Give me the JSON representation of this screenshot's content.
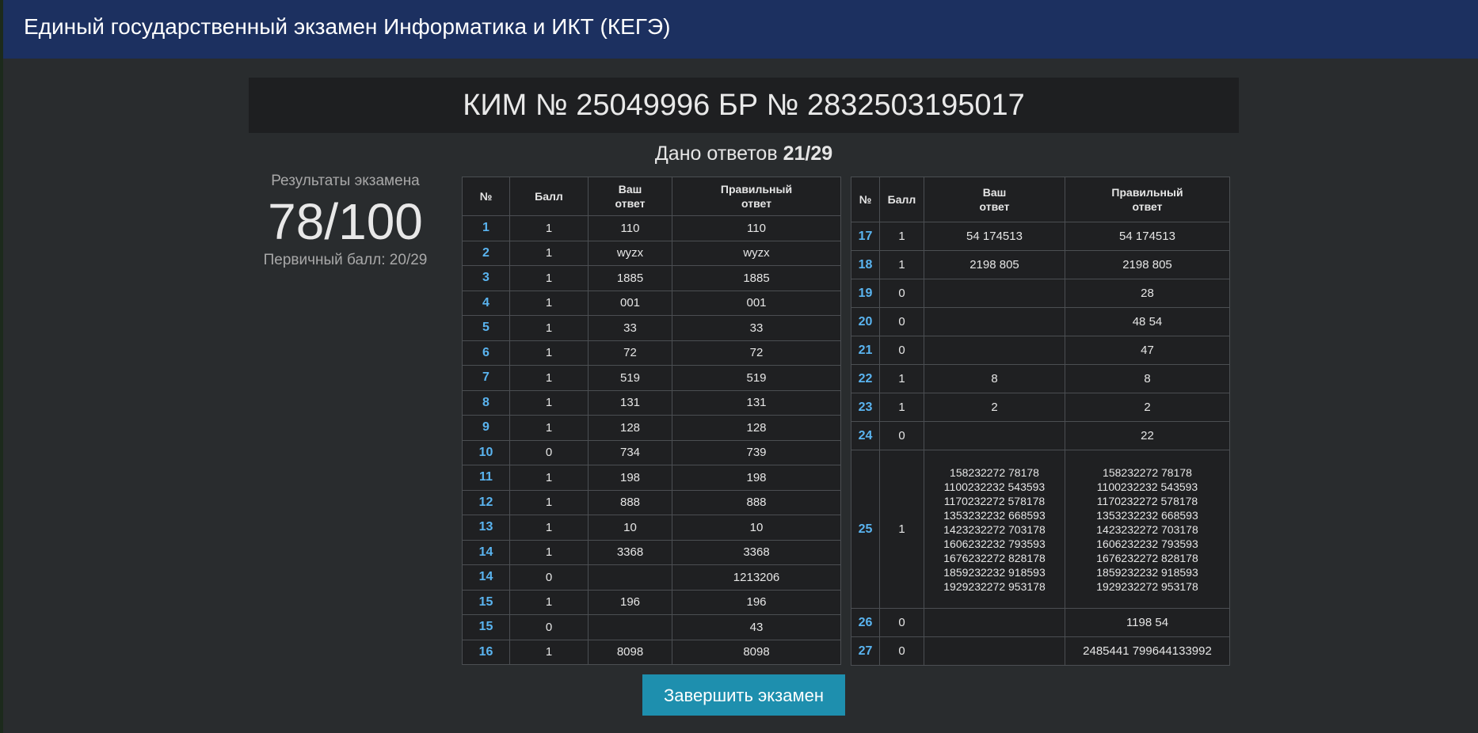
{
  "header": {
    "title": "Единый государственный экзамен Информатика и ИКТ (КЕГЭ)"
  },
  "kim": {
    "text": "КИМ № 25049996 БР № 2832503195017"
  },
  "progress": {
    "label": "Дано ответов",
    "value": "21/29"
  },
  "results": {
    "label": "Результаты экзамена",
    "score": "78/100",
    "primary": "Первичный балл: 20/29"
  },
  "table_headers": {
    "num": "№",
    "score": "Балл",
    "yours_1": "Ваш",
    "yours_2": "ответ",
    "correct_1": "Правильный",
    "correct_2": "ответ"
  },
  "left_rows": [
    {
      "n": "1",
      "s": "1",
      "y": "110",
      "c": "110"
    },
    {
      "n": "2",
      "s": "1",
      "y": "wyzx",
      "c": "wyzx"
    },
    {
      "n": "3",
      "s": "1",
      "y": "1885",
      "c": "1885"
    },
    {
      "n": "4",
      "s": "1",
      "y": "001",
      "c": "001"
    },
    {
      "n": "5",
      "s": "1",
      "y": "33",
      "c": "33"
    },
    {
      "n": "6",
      "s": "1",
      "y": "72",
      "c": "72"
    },
    {
      "n": "7",
      "s": "1",
      "y": "519",
      "c": "519"
    },
    {
      "n": "8",
      "s": "1",
      "y": "131",
      "c": "131"
    },
    {
      "n": "9",
      "s": "1",
      "y": "128",
      "c": "128"
    },
    {
      "n": "10",
      "s": "0",
      "y": "734",
      "c": "739"
    },
    {
      "n": "11",
      "s": "1",
      "y": "198",
      "c": "198"
    },
    {
      "n": "12",
      "s": "1",
      "y": "888",
      "c": "888"
    },
    {
      "n": "13",
      "s": "1",
      "y": "10",
      "c": "10"
    },
    {
      "n": "14",
      "s": "1",
      "y": "3368",
      "c": "3368"
    },
    {
      "n": "14",
      "s": "0",
      "y": "",
      "c": "1213206"
    },
    {
      "n": "15",
      "s": "1",
      "y": "196",
      "c": "196"
    },
    {
      "n": "15",
      "s": "0",
      "y": "",
      "c": "43"
    },
    {
      "n": "16",
      "s": "1",
      "y": "8098",
      "c": "8098"
    }
  ],
  "right_rows": [
    {
      "n": "17",
      "s": "1",
      "y": "54 174513",
      "c": "54 174513"
    },
    {
      "n": "18",
      "s": "1",
      "y": "2198 805",
      "c": "2198 805"
    },
    {
      "n": "19",
      "s": "0",
      "y": "",
      "c": "28"
    },
    {
      "n": "20",
      "s": "0",
      "y": "",
      "c": "48 54"
    },
    {
      "n": "21",
      "s": "0",
      "y": "",
      "c": "47"
    },
    {
      "n": "22",
      "s": "1",
      "y": "8",
      "c": "8"
    },
    {
      "n": "23",
      "s": "1",
      "y": "2",
      "c": "2"
    },
    {
      "n": "24",
      "s": "0",
      "y": "",
      "c": "22"
    },
    {
      "n": "25",
      "s": "1",
      "y": [
        "158232272 78178",
        "1100232232 543593",
        "1170232272 578178",
        "1353232232 668593",
        "1423232272 703178",
        "1606232232 793593",
        "1676232272 828178",
        "1859232232 918593",
        "1929232272 953178"
      ],
      "c": [
        "158232272 78178",
        "1100232232 543593",
        "1170232272 578178",
        "1353232232 668593",
        "1423232272 703178",
        "1606232232 793593",
        "1676232272 828178",
        "1859232232 918593",
        "1929232272 953178"
      ]
    },
    {
      "n": "26",
      "s": "0",
      "y": "",
      "c": "1198 54"
    },
    {
      "n": "27",
      "s": "0",
      "y": "",
      "c": "2485441 799644133992"
    }
  ],
  "finish_button": {
    "label": "Завершить экзамен"
  },
  "colors": {
    "header_bg": "#1c3060",
    "page_bg": "#292c2e",
    "task_number": "#5ab4f0",
    "button_bg": "#1e8fae"
  }
}
